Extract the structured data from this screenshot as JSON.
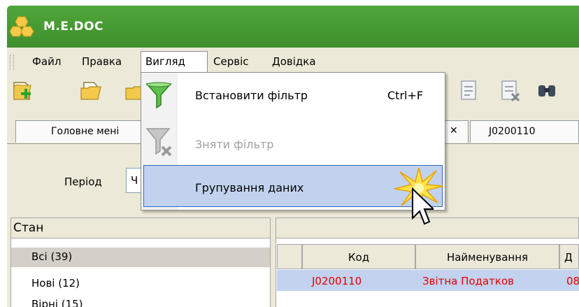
{
  "app": {
    "title": "M.E.DOC"
  },
  "menu": {
    "items": [
      {
        "label": "Файл"
      },
      {
        "label": "Правка"
      },
      {
        "label": "Вигляд"
      },
      {
        "label": "Сервіс"
      },
      {
        "label": "Довідка"
      }
    ]
  },
  "view_menu": {
    "items": [
      {
        "label": "Встановити фільтр",
        "shortcut": "Ctrl+F",
        "icon": "filter-icon",
        "enabled": true
      },
      {
        "label": "Зняти фільтр",
        "icon": "remove-filter-icon",
        "enabled": false
      },
      {
        "label": "Групування даних",
        "highlighted": true
      }
    ]
  },
  "tabs": {
    "main": "Головне мені",
    "close_symbol": "✕",
    "doc": "J0200110"
  },
  "filter": {
    "period_label": "Період",
    "period_value": "Ч"
  },
  "state_panel": {
    "header": "Стан",
    "items": [
      "Всі (39)",
      "Нові (12)",
      "Вірні (15)"
    ]
  },
  "grid": {
    "columns": [
      "Код",
      "Найменування",
      "Д"
    ],
    "rows": [
      [
        "J0200110",
        "Звітна Податков",
        "08"
      ]
    ]
  },
  "colors": {
    "title_bar": "#4fa63a",
    "highlight": "#c1d2ee",
    "error_text": "#e00000"
  }
}
